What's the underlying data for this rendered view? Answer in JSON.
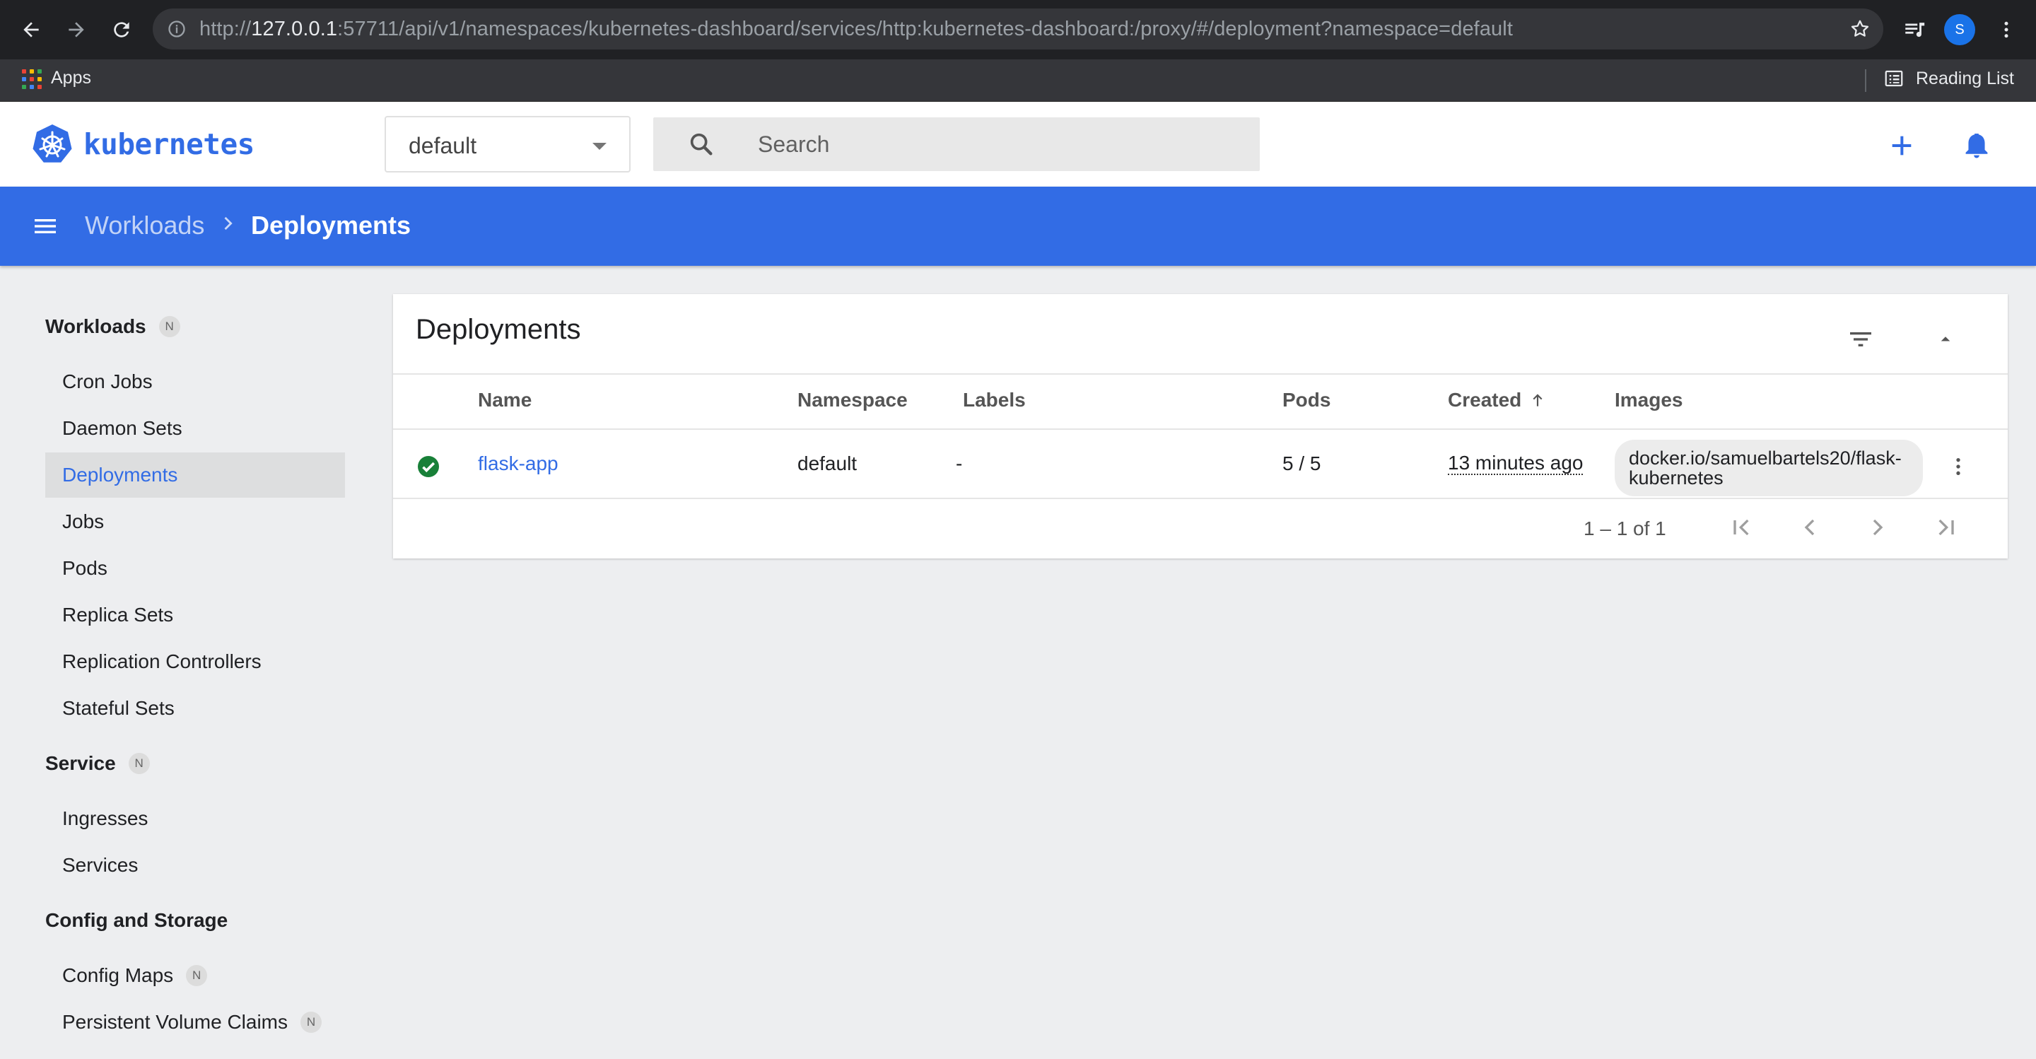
{
  "browser": {
    "url_prefix": "http://",
    "url_host": "127.0.0.1",
    "url_rest": ":57711/api/v1/namespaces/kubernetes-dashboard/services/http:kubernetes-dashboard:/proxy/#/deployment?namespace=default",
    "profile_initial": "S",
    "bookmarks": {
      "apps_label": "Apps",
      "reading_list_label": "Reading List"
    }
  },
  "header": {
    "brand": "kubernetes",
    "namespace": "default",
    "search_placeholder": "Search",
    "brand_color": "#326ce5"
  },
  "toolbar": {
    "breadcrumb_parent": "Workloads",
    "breadcrumb_current": "Deployments"
  },
  "sidebar": {
    "sections": [
      {
        "label": "Workloads",
        "badge": "N",
        "items": [
          "Cron Jobs",
          "Daemon Sets",
          "Deployments",
          "Jobs",
          "Pods",
          "Replica Sets",
          "Replication Controllers",
          "Stateful Sets"
        ]
      },
      {
        "label": "Service",
        "badge": "N",
        "items": [
          "Ingresses",
          "Services"
        ]
      },
      {
        "label": "Config and Storage",
        "badge": "",
        "items": [
          "Config Maps",
          "Persistent Volume Claims"
        ],
        "item_badges": [
          "N",
          "N"
        ]
      }
    ],
    "active_item": "Deployments"
  },
  "card": {
    "title": "Deployments",
    "columns": [
      "Name",
      "Namespace",
      "Labels",
      "Pods",
      "Created",
      "Images"
    ],
    "rows": [
      {
        "status": "running",
        "name": "flask-app",
        "namespace": "default",
        "labels": "-",
        "pods": "5 / 5",
        "created": "13 minutes ago",
        "image": "docker.io/samuelbartels20/flask-kubernetes"
      }
    ],
    "pager": {
      "range": "1 – 1 of 1"
    }
  }
}
